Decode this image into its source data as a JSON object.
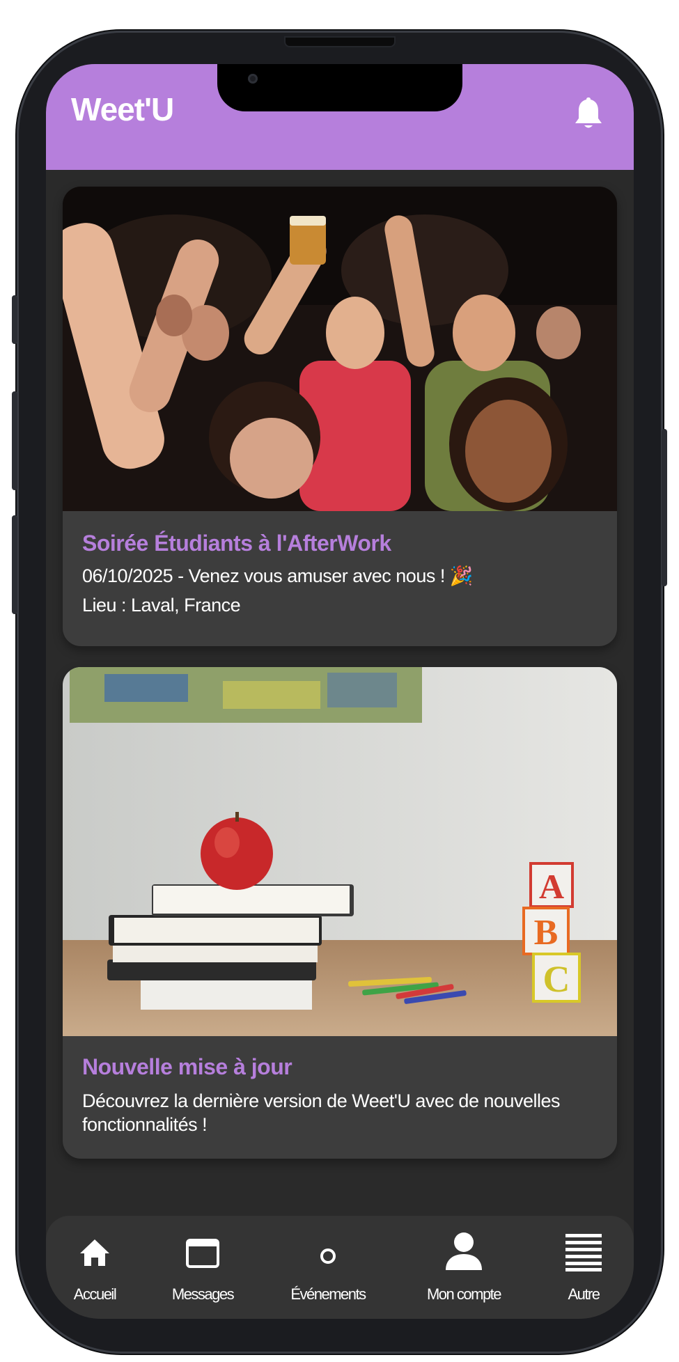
{
  "app": {
    "title": "Weet'U",
    "header_color": "#b67fdc"
  },
  "header": {
    "notification_icon": "bell-icon"
  },
  "feed": [
    {
      "title": "Soirée Étudiants à l'AfterWork",
      "description": "06/10/2025 - Venez vous amuser avec nous ! 🎉",
      "location": "Lieu : Laval, France",
      "image": "party-crowd-photo"
    },
    {
      "title": "Nouvelle mise à jour",
      "description": "Découvrez la dernière version de Weet'U avec de nouvelles fonctionnalités !",
      "image": "apple-books-abc-blocks-photo"
    }
  ],
  "bottom_nav": [
    {
      "label": "Accueil",
      "icon": "home-icon"
    },
    {
      "label": "Messages",
      "icon": "window-icon"
    },
    {
      "label": "Événements",
      "icon": "circle-icon"
    },
    {
      "label": "Mon compte",
      "icon": "person-icon"
    },
    {
      "label": "Autre",
      "icon": "menu-lines-icon"
    }
  ],
  "colors": {
    "accent": "#b67fdc",
    "background": "#2a2a2a",
    "card": "#3d3d3d",
    "nav": "#343434"
  }
}
